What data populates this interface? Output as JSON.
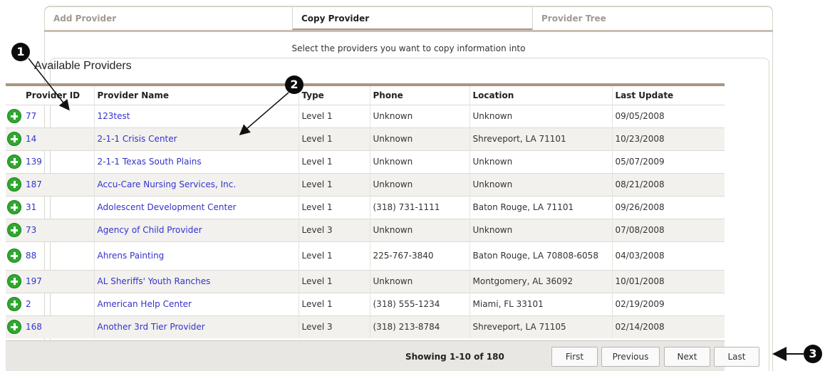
{
  "tabs": [
    {
      "label": "Add Provider"
    },
    {
      "label": "Copy Provider"
    },
    {
      "label": "Provider Tree"
    }
  ],
  "instruction": "Select the providers you want to copy information into",
  "panel": {
    "title": "Available Providers"
  },
  "table": {
    "headers": {
      "id": "Provider ID",
      "name": "Provider Name",
      "type": "Type",
      "phone": "Phone",
      "location": "Location",
      "updated": "Last Update"
    },
    "rows": [
      {
        "id": "77",
        "name": "123test",
        "type": "Level 1",
        "phone": "Unknown",
        "location": "Unknown",
        "updated": "09/05/2008"
      },
      {
        "id": "14",
        "name": "2-1-1 Crisis Center",
        "type": "Level 1",
        "phone": "Unknown",
        "location": "Shreveport, LA 71101",
        "updated": "10/23/2008"
      },
      {
        "id": "139",
        "name": "2-1-1 Texas South Plains",
        "type": "Level 1",
        "phone": "Unknown",
        "location": "Unknown",
        "updated": "05/07/2009"
      },
      {
        "id": "187",
        "name": "Accu-Care Nursing Services, Inc.",
        "type": "Level 1",
        "phone": "Unknown",
        "location": "Unknown",
        "updated": "08/21/2008"
      },
      {
        "id": "31",
        "name": "Adolescent Development Center",
        "type": "Level 1",
        "phone": "(318) 731-1111",
        "location": "Baton Rouge, LA 71101",
        "updated": "09/26/2008"
      },
      {
        "id": "73",
        "name": "Agency of Child Provider",
        "type": "Level 3",
        "phone": "Unknown",
        "location": "Unknown",
        "updated": "07/08/2008"
      },
      {
        "id": "88",
        "name": "Ahrens Painting",
        "type": "Level 1",
        "phone": "225-767-3840",
        "location": "Baton Rouge, LA 70808-6058",
        "updated": "04/03/2008"
      },
      {
        "id": "197",
        "name": "AL Sheriffs' Youth Ranches",
        "type": "Level 1",
        "phone": "Unknown",
        "location": "Montgomery, AL 36092",
        "updated": "10/01/2008"
      },
      {
        "id": "2",
        "name": "American Help Center",
        "type": "Level 1",
        "phone": "(318) 555-1234",
        "location": "Miami, FL 33101",
        "updated": "02/19/2009"
      },
      {
        "id": "168",
        "name": "Another 3rd Tier Provider",
        "type": "Level 3",
        "phone": "(318) 213-8784",
        "location": "Shreveport, LA 71105",
        "updated": "02/14/2008"
      }
    ]
  },
  "pagination": {
    "showing": "Showing 1-10 of 180",
    "first": "First",
    "previous": "Previous",
    "next": "Next",
    "last": "Last"
  },
  "callouts": {
    "one": "1",
    "two": "2",
    "three": "3"
  },
  "icons": {
    "add": "add-icon"
  },
  "colors": {
    "link": "#3333cc",
    "add_icon": "#2fa82f",
    "accent_line": "#a7977f"
  }
}
